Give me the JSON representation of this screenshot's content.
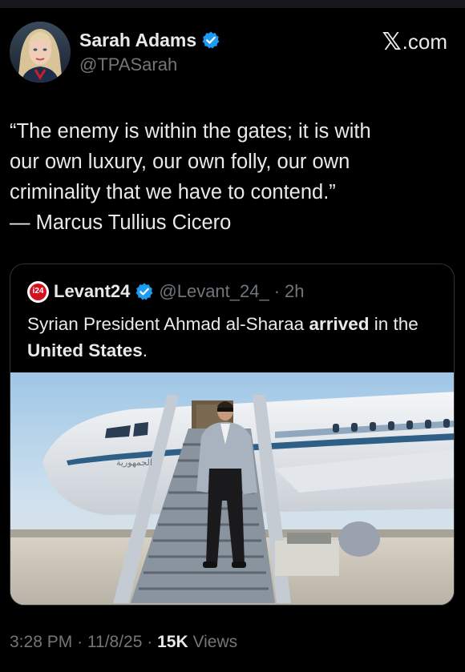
{
  "author": {
    "display_name": "Sarah Adams",
    "handle": "@TPASarah",
    "verified": true,
    "avatar_icon": "profile-photo-avatar"
  },
  "source_logo": {
    "glyph": "𝕏",
    "text": ".com"
  },
  "tweet": {
    "lines": [
      "“The enemy is within the gates; it is with",
      "our own luxury, our own folly, our own",
      "criminality that we have to contend.”",
      "— Marcus Tullius Cicero"
    ]
  },
  "quote": {
    "avatar_text": "i24",
    "name": "Levant24",
    "verified": true,
    "handle": "@Levant_24_",
    "dot": "·",
    "time": "2h",
    "text_parts": [
      "Syrian President Ahmad al-Sharaa ",
      "arrived",
      " in the ",
      "United States",
      "."
    ],
    "image_icon": "airplane-stairs-photo"
  },
  "meta": {
    "time": "3:28 PM",
    "sep1": "·",
    "date": "11/8/25",
    "sep2": "·",
    "views_count": "15K",
    "views_label": "Views"
  },
  "colors": {
    "background": "#000000",
    "text_primary": "#e7e9ea",
    "text_secondary": "#71767b",
    "verified_blue": "#1d9bf0",
    "border": "#2f3336"
  }
}
